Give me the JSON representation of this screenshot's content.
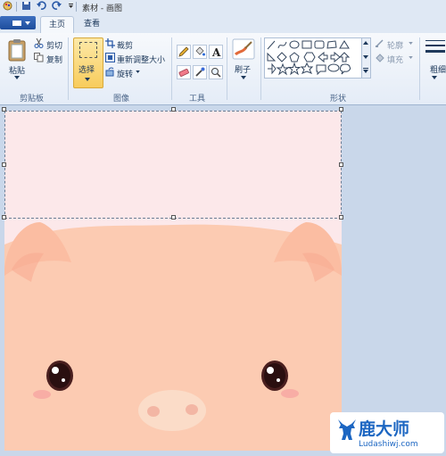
{
  "window": {
    "title": "素材 - 画图"
  },
  "tabs": [
    {
      "label": "主页"
    },
    {
      "label": "查看"
    }
  ],
  "ribbon": {
    "clipboard": {
      "paste": "粘贴",
      "cut": "剪切",
      "copy": "复制",
      "group_label": "剪贴板"
    },
    "image": {
      "select": "选择",
      "crop": "裁剪",
      "resize": "重新调整大小",
      "rotate": "旋转",
      "group_label": "图像"
    },
    "tools": {
      "group_label": "工具"
    },
    "brushes": {
      "label": "刷子"
    },
    "shapes": {
      "outline": "轮廓",
      "fill": "填充",
      "group_label": "形状"
    },
    "size": {
      "label": "粗细"
    }
  },
  "watermark": {
    "brand": "鹿大师",
    "url": "Ludashiwj.com"
  },
  "colors": {
    "canvas_top": "#fce8ea",
    "pig_skin": "#fccbb2",
    "selection_accent": "#f8cc5c"
  }
}
